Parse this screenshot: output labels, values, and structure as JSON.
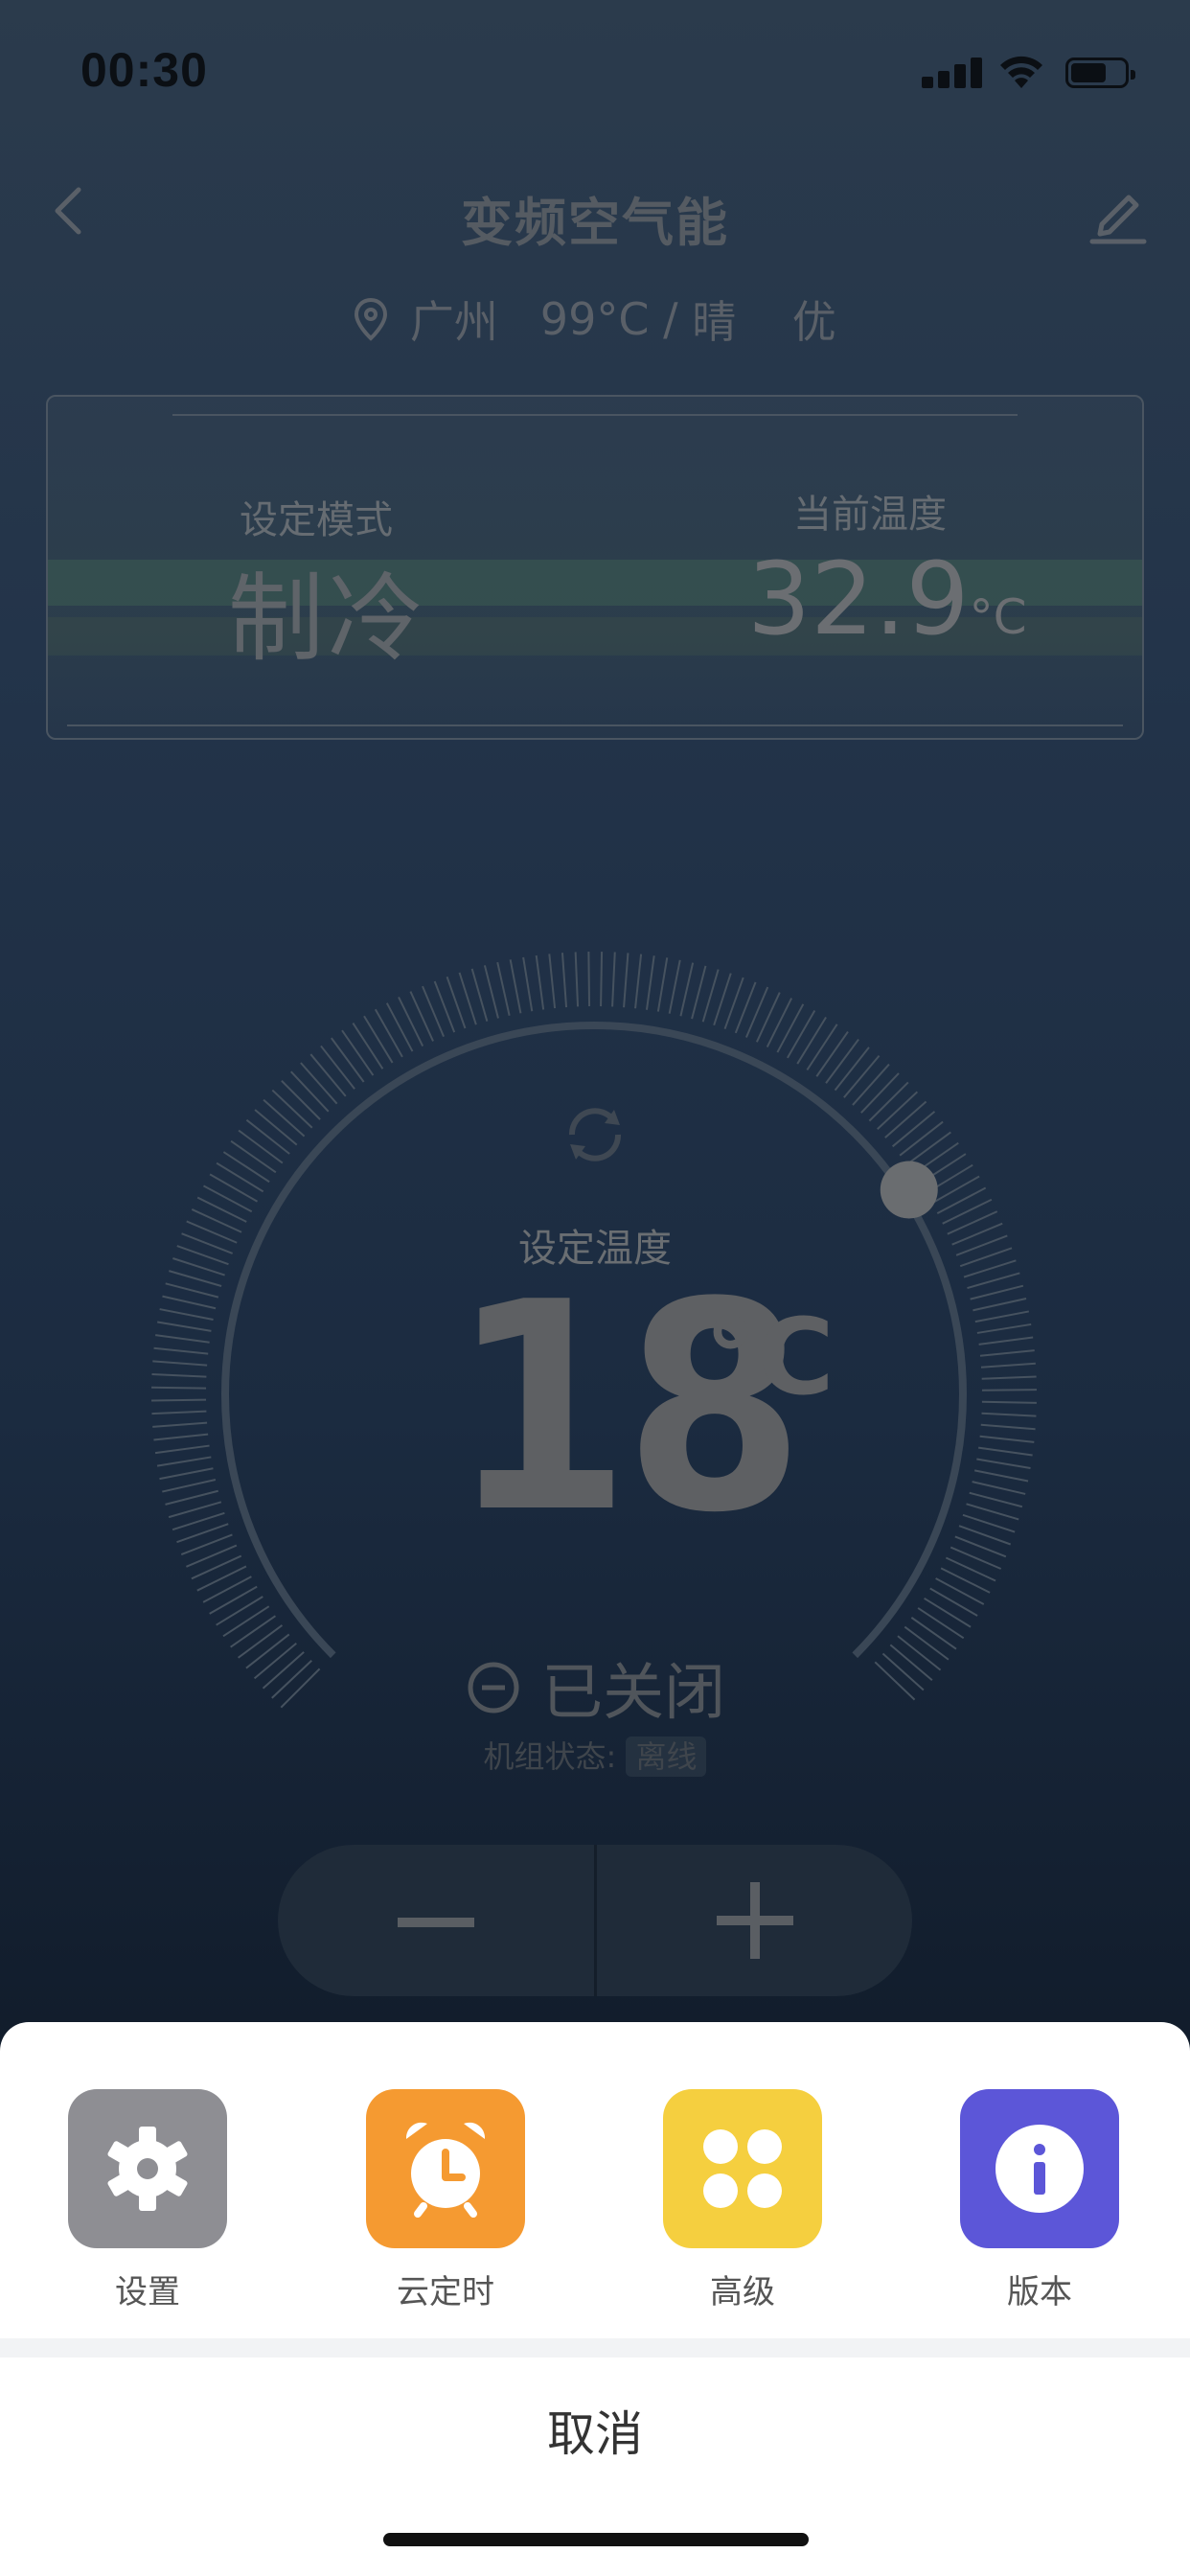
{
  "status_bar": {
    "time": "00:30"
  },
  "nav": {
    "title": "变频空气能"
  },
  "weather": {
    "city": "广州",
    "temp": "99°C",
    "sep": "/",
    "condition": "晴",
    "air_quality": "优"
  },
  "info_card": {
    "mode_label": "设定模式",
    "mode_value": "制冷",
    "current_label": "当前温度",
    "current_value": "32.9",
    "current_unit": "°C"
  },
  "dial": {
    "label": "设定温度",
    "set_temp": "18",
    "unit": "°C",
    "power_status": "已关闭",
    "unit_state_label": "机组状态:",
    "unit_state_value": "离线"
  },
  "stepper": {
    "minus": "−",
    "plus": "+"
  },
  "sheet": {
    "items": [
      {
        "label": "设置",
        "icon": "gear-icon",
        "color": "#8e8e93"
      },
      {
        "label": "云定时",
        "icon": "alarm-clock-icon",
        "color": "#f59a31"
      },
      {
        "label": "高级",
        "icon": "grid-icon",
        "color": "#f5cf3f"
      },
      {
        "label": "版本",
        "icon": "info-icon",
        "color": "#5c56d8"
      }
    ],
    "cancel": "取消"
  }
}
